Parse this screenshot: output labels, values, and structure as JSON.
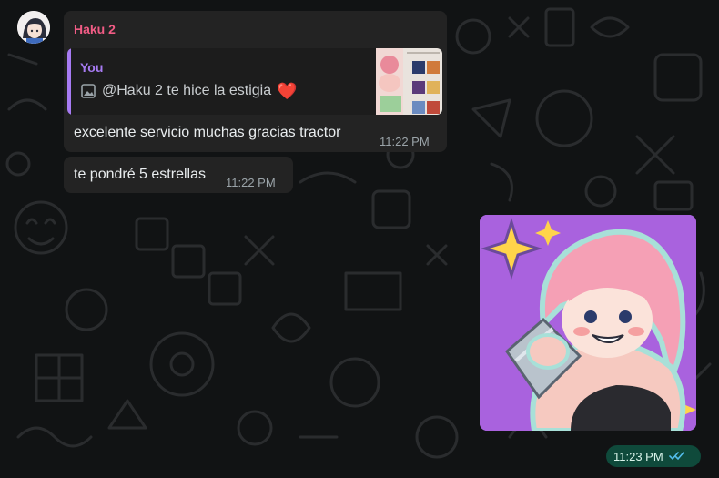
{
  "chat": {
    "incoming_message": {
      "sender": "Haku 2",
      "quote": {
        "author": "You",
        "icon": "image-icon",
        "text": "@Haku 2 te hice la estigia",
        "emoji": "❤️"
      },
      "text": "excelente servicio muchas gracias tractor",
      "time": "11:22 PM"
    },
    "second_message": {
      "text": "te pondré 5 estrellas",
      "time": "11:22 PM"
    },
    "outgoing_image": {
      "time": "11:23 PM",
      "status_icon": "double-check-icon"
    }
  },
  "colors": {
    "background": "#111314",
    "bubble_in": "#232323",
    "sender_color": "#f15c85",
    "quote_color": "#a77bf3",
    "bubble_out_time": "#0f4a3b",
    "read_tick": "#53bdeb"
  }
}
